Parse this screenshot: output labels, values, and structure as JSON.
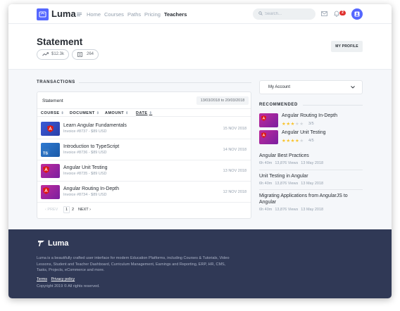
{
  "brand": {
    "name": "Luma"
  },
  "nav": {
    "links": [
      "Home",
      "Courses",
      "Paths",
      "Pricing",
      "Teachers"
    ],
    "active": "Teachers",
    "search_placeholder": "Search...",
    "notification_count": "2"
  },
  "header": {
    "title": "Statement",
    "earnings": "$12.3k",
    "count": "264",
    "profile_button": "MY PROFILE"
  },
  "transactions": {
    "section_label": "TRANSACTIONS",
    "card_title": "Statement",
    "date_range": "13/03/2018 to 20/03/2018",
    "columns": [
      "COURSE",
      "DOCUMENT",
      "AMOUNT",
      "DATE"
    ],
    "rows": [
      {
        "title": "Learn Angular Fundamentals",
        "invoice": "Invoice #8737 - $89 USD",
        "date": "15 NOV 2018",
        "thumb": "angular-blue"
      },
      {
        "title": "Introduction to TypeScript",
        "invoice": "Invoice #8736 - $89 USD",
        "date": "14 NOV 2018",
        "thumb": "typescript"
      },
      {
        "title": "Angular Unit Testing",
        "invoice": "Invoice #8735 - $89 USD",
        "date": "13 NOV 2018",
        "thumb": "angular-purple"
      },
      {
        "title": "Angular Routing In-Depth",
        "invoice": "Invoice #8734 - $89 USD",
        "date": "12 NOV 2018",
        "thumb": "angular-purple"
      }
    ],
    "pager": {
      "prev": "‹ PREV",
      "pages": [
        "1",
        "2"
      ],
      "next": "NEXT ›"
    }
  },
  "account": {
    "label": "My Account"
  },
  "recommended": {
    "section_label": "RECOMMENDED",
    "items": [
      {
        "title": "Angular Routing In-Depth",
        "rating": "3/5",
        "stars": 3
      },
      {
        "title": "Angular Unit Testing",
        "rating": "4/5",
        "stars": 4
      }
    ]
  },
  "courses": [
    {
      "title": "Angular Best Practices",
      "duration": "6h 40m",
      "views": "13,876 Views",
      "date": "13 May 2018"
    },
    {
      "title": "Unit Testing in Angular",
      "duration": "6h 40m",
      "views": "13,876 Views",
      "date": "13 May 2018"
    },
    {
      "title": "Migrating Applications from AngularJS to Angular",
      "duration": "6h 40m",
      "views": "13,876 Views",
      "date": "13 May 2018"
    }
  ],
  "footer": {
    "brand": "Luma",
    "description": "Luma is a beautifully crafted user interface for modern Education Platforms, including Courses & Tutorials, Video Lessons, Student and Teacher Dashboard, Curriculum Management, Earnings and Reporting, ERP, HR, CMS, Tasks, Projects, eCommerce and more.",
    "links": [
      "Terms",
      "Privacy policy"
    ],
    "copyright": "Copyright 2019 © All rights reserved."
  },
  "colors": {
    "accent": "#5567ff",
    "footer": "#303956",
    "star": "#f9c32b",
    "badge": "#e0312e"
  }
}
